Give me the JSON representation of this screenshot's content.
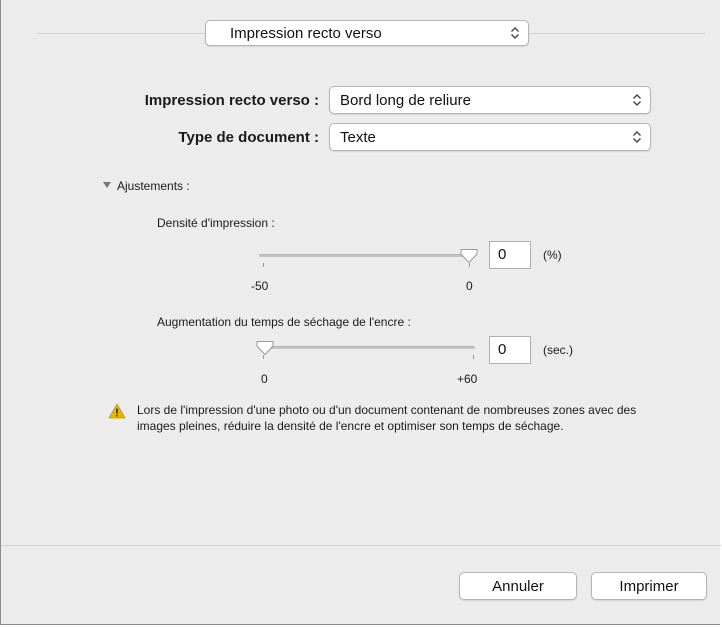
{
  "panel_selector": {
    "value": "Impression recto verso",
    "icon": "updown-arrows-icon"
  },
  "duplex": {
    "label": "Impression recto verso :",
    "value": "Bord long de reliure"
  },
  "document_type": {
    "label": "Type de document :",
    "value": "Texte"
  },
  "adjustments": {
    "label": "Ajustements :",
    "expanded": true,
    "density": {
      "label": "Densité d'impression :",
      "value": "0",
      "unit": "(%)",
      "min_label": "-50",
      "max_label": "0",
      "min": -50,
      "max": 0,
      "current": 0
    },
    "drying": {
      "label": "Augmentation du temps de séchage de l'encre :",
      "value": "0",
      "unit": "(sec.)",
      "min_label": "0",
      "max_label": "+60",
      "min": 0,
      "max": 60,
      "current": 0
    }
  },
  "warning": {
    "icon": "warning-icon",
    "text": "Lors de l'impression d'une photo ou d'un document contenant de nombreuses zones avec des images pleines, réduire la densité de l'encre et optimiser son temps de séchage."
  },
  "buttons": {
    "cancel": "Annuler",
    "print": "Imprimer"
  },
  "colors": {
    "warning": "#e8b400",
    "dialog_bg": "#ececec"
  }
}
